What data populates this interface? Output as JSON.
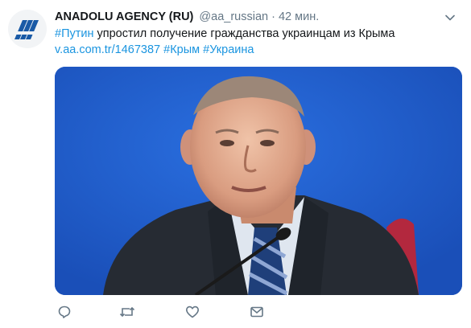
{
  "tweet": {
    "author_name": "ANADOLU AGENCY (RU)",
    "author_handle": "@aa_russian",
    "separator": "·",
    "time": "42 мин.",
    "hashtag_putin": "#Путин",
    "body_text": " упростил получение гражданства украинцам из Крыма",
    "link": "v.aa.com.tr/1467387",
    "hashtag_crimea": "#Крым",
    "hashtag_ukraine": "#Украина"
  },
  "avatar": {
    "icon": "anadolu-logo-icon",
    "color": "#1a5aa6"
  },
  "media": {
    "icon": "press-photo-icon",
    "background": "#1f5fd4"
  },
  "actions": [
    {
      "icon": "reply-icon"
    },
    {
      "icon": "retweet-icon"
    },
    {
      "icon": "like-icon"
    },
    {
      "icon": "direct-message-icon"
    }
  ],
  "colors": {
    "link": "#1b95e0",
    "secondary_text": "#657786",
    "icon": "#657786"
  }
}
